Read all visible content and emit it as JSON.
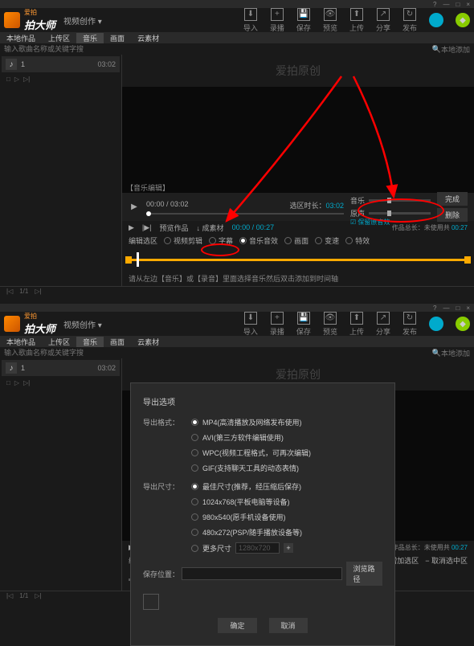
{
  "titlebar": {
    "help": "?",
    "min": "—",
    "max": "□",
    "close": "×"
  },
  "brand": {
    "top": "爱拍",
    "main": "拍大师",
    "dropdown": "视频创作 ▾"
  },
  "toolbar": {
    "import": "导入",
    "record": "录播",
    "save": "保存",
    "preview": "预览",
    "upload": "上传",
    "share": "分享",
    "publish": "发布"
  },
  "subtabs": {
    "tab1": "本地作品",
    "tab2": "上传区",
    "tab3": "音乐",
    "tab4": "画面",
    "tab5": "云素材"
  },
  "search": {
    "placeholder": "输入歌曲名称或关键字搜",
    "icon": "🔍",
    "local_add": "本地添加"
  },
  "track": {
    "num": "1",
    "duration": "03:02",
    "icon": "♪"
  },
  "track_ctrl": {
    "checkbox": "□",
    "play": "▷",
    "next": "▷|"
  },
  "watermark": "爱拍原创",
  "audio_label": "【音乐编辑】",
  "player": {
    "play": "▶",
    "time": "00:00 / 03:02",
    "dur_label": "选区时长：",
    "dur_value": "03:02",
    "music": "音乐",
    "vol_sound": "原声",
    "done": "完成",
    "delete": "删除",
    "orig_check": "保留原音效"
  },
  "tabs": {
    "play": "▶",
    "step": "|▶|",
    "preview_work": "预览作品",
    "add_material": "↓ 成素材",
    "tc": "00:00 / 00:27",
    "info": "作品总长：未使用共",
    "info2": "00:27"
  },
  "edit": {
    "label": "编辑选区",
    "r1": "视频剪辑",
    "r2": "字幕",
    "r3": "音乐音效",
    "r4": "画面",
    "r5": "变速",
    "r6": "特效",
    "add_region": "+ 增加选区",
    "cancel_region": "− 取消选中区"
  },
  "hint": "请从左边【音乐】或【录音】里面选择音乐然后双击添加到时间轴",
  "footer": {
    "nav1": "|◁",
    "page": "1/1",
    "nav2": "▷|"
  },
  "modal": {
    "title": "导出选项",
    "format_label": "导出格式：",
    "f1": "MP4(高清播放及网络发布使用)",
    "f2": "AVI(第三方软件编辑使用)",
    "f3": "WPC(视频工程格式，可再次编辑)",
    "f4": "GIF(支持聊天工具的动态表情)",
    "size_label": "导出尺寸：",
    "s1": "最佳尺寸(推荐，经压缩后保存)",
    "s2": "1024x768(平板电脑等设备)",
    "s3": "980x540(愿手机设备使用)",
    "s4": "480x272(PSP/随手播放设备等)",
    "s5": "更多尺寸",
    "size_custom": "1280x720",
    "path_label": "保存位置：",
    "browse": "浏览路径",
    "ok": "确定",
    "cancel": "取消"
  }
}
